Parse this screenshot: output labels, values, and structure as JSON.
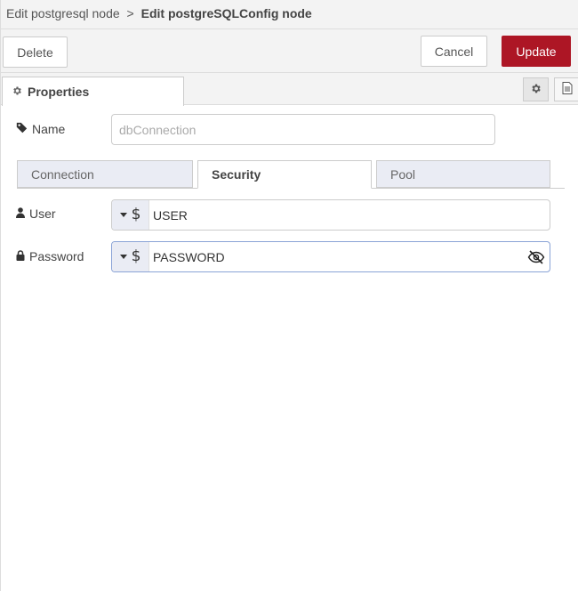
{
  "breadcrumb": {
    "parent": "Edit postgresql node",
    "separator": ">",
    "current": "Edit postgreSQLConfig node"
  },
  "toolbar": {
    "delete_label": "Delete",
    "cancel_label": "Cancel",
    "update_label": "Update"
  },
  "tabs": {
    "properties_label": "Properties"
  },
  "form": {
    "name": {
      "label": "Name",
      "placeholder": "dbConnection",
      "value": ""
    }
  },
  "sub_tabs": [
    {
      "label": "Connection",
      "active": false
    },
    {
      "label": "Security",
      "active": true
    },
    {
      "label": "Pool",
      "active": false
    }
  ],
  "security": {
    "user": {
      "label": "User",
      "type_symbol": "$",
      "value": "USER"
    },
    "password": {
      "label": "Password",
      "type_symbol": "$",
      "value": "PASSWORD"
    }
  },
  "colors": {
    "accent": "#AD1625",
    "tab_inactive_bg": "#eaecf4",
    "header_bg": "#f3f3f3"
  },
  "icons": {
    "name_label": "tag-icon",
    "user_label": "user-icon",
    "password_label": "lock-icon",
    "properties_tab": "gear-icon",
    "type_select_caret": "caret-down-icon",
    "env_var_type": "dollar-icon",
    "password_visibility": "eye-off-icon",
    "side_buttons": [
      "gear-icon",
      "document-icon"
    ]
  }
}
